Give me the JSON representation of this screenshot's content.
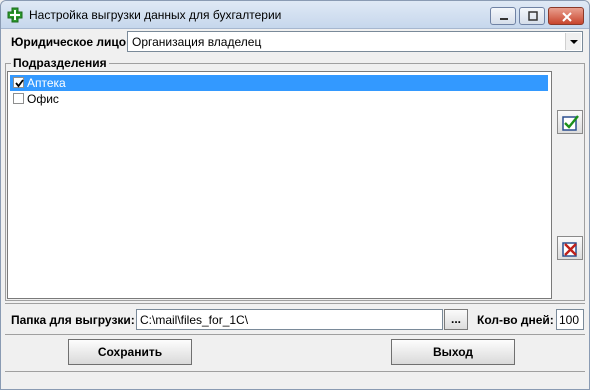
{
  "window": {
    "title": "Настройка выгрузки данных для бухгалтерии",
    "icon": "green-cross-icon"
  },
  "legal_entity": {
    "label": "Юридическое лицо:",
    "value": "Организация владелец"
  },
  "departments": {
    "label": "Подразделения",
    "items": [
      {
        "label": "Аптека",
        "checked": true,
        "selected": true
      },
      {
        "label": "Офис",
        "checked": false,
        "selected": false
      }
    ],
    "check_all_icon": "check-all-icon",
    "uncheck_all_icon": "uncheck-all-icon"
  },
  "export_folder": {
    "label": "Папка для выгрузки:",
    "value": "C:\\mail\\files_for_1C\\",
    "browse_label": "..."
  },
  "days": {
    "label": "Кол-во дней:",
    "value": "100"
  },
  "buttons": {
    "save": "Сохранить",
    "exit": "Выход"
  },
  "colors": {
    "selection": "#3399ff",
    "accent_green": "#2e9b2e",
    "close_red": "#c8452d"
  }
}
